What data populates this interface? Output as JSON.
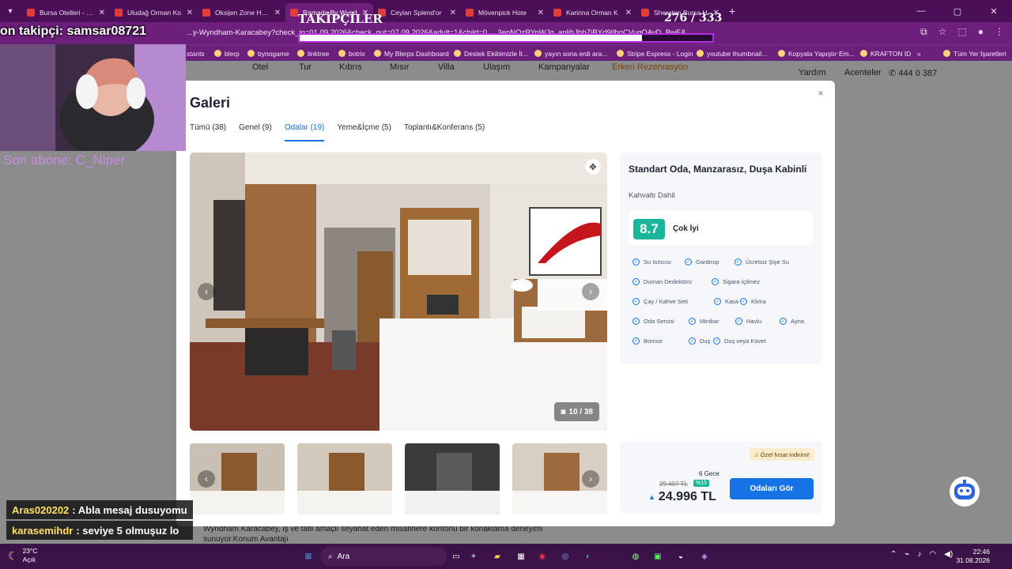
{
  "browser": {
    "tabs": [
      {
        "label": "Bursa Otelleri - En"
      },
      {
        "label": "Uludağ Orman Ko"
      },
      {
        "label": "Oksijen Zone Hote"
      },
      {
        "label": "Ramada By Wynd",
        "active": true
      },
      {
        "label": "Ceylan Splend'or"
      },
      {
        "label": "Mövenpick Hote"
      },
      {
        "label": "Karinna Orman K"
      },
      {
        "label": "Sheraton Bursa H"
      }
    ],
    "url": "...y-Wyndham-Karacabey?check_in=01.09.2026&check_out=07.09.2026&adult=1&child=0 ... 3epNOzRYpWJq_aplihJbbZiBYd9IlhoCVugQAvD_BwE&...",
    "bookmarks": [
      "stants",
      "blerp",
      "bynogame",
      "linktree",
      "botrix",
      "My Blerps Dashboard",
      "Destek Ekibimizle İl...",
      "yayın sona erdi ara...",
      "Stripe Express - Login",
      "youtube thumbnail...",
      "Kopyala Yapıştır Em...",
      "KRAFTON ID",
      "»",
      "Tüm Yer İşaretleri"
    ]
  },
  "page": {
    "nav": [
      "Otel",
      "Tur",
      "Kıbrıs",
      "Mısır",
      "Villa",
      "Ulaşım",
      "Kampanyalar",
      "Erken Rezervasyon"
    ],
    "help": "Yardım",
    "agents": "Acenteler",
    "phone": "444 0 387",
    "description": "Wyndham Karacabey, iş ve tatil amaçlı seyahat eden misafirlere konforlu bir konaklama deneyimi sunuyor.Konum Avantajı"
  },
  "gallery": {
    "title": "Galeri",
    "close": "×",
    "tabs": [
      {
        "label": "Tümü (38)"
      },
      {
        "label": "Genel (9)"
      },
      {
        "label": "Odalar (19)",
        "active": true
      },
      {
        "label": "Yeme&İçme (5)"
      },
      {
        "label": "Toplantı&Konferans (5)"
      }
    ],
    "counter": "10 / 38",
    "thumb_count": 4
  },
  "room": {
    "title": "Standart Oda, Manzarasız, Duşa Kabinli",
    "board": "Kahvaltı Dahil",
    "score": "8.7",
    "score_label": "Çok İyi",
    "amenities": [
      "Su Isıtıcısı",
      "Gardırop",
      "Ücretsiz Şişe Su",
      "Duman Dedektörü",
      "Sigara İçilmez",
      "Çay / Kahve Seti",
      "Kasa",
      "Klima",
      "Oda Servisi",
      "Minibar",
      "Havlu",
      "Ayna",
      "Bornoz",
      "Duş",
      "Duş veya Küvet"
    ]
  },
  "pricing": {
    "promo": "Özel fırsat indirimi!",
    "nights": "6 Gece",
    "old_price": "29.407 TL",
    "discount": "%15",
    "price": "24.996 TL",
    "cta": "Odaları Gör"
  },
  "stream": {
    "follower_ticker": "on takipçi: samsar08721",
    "last_sub": "Son abone: C_Niper",
    "followers_title": "TAKİPÇİLER",
    "followers_count": "276 / 333",
    "followers_progress": 0.83,
    "chat": [
      {
        "user": "Aras020202",
        "message": ": Abla mesaj dusuyomu"
      },
      {
        "user": "karasemihdr",
        "message": ": seviye 5 olmuşuz lo"
      }
    ]
  },
  "taskbar": {
    "temperature": "23°C",
    "weather": "Açık",
    "search_placeholder": "Ara",
    "time": "22:46",
    "date": "31.08.2026"
  }
}
